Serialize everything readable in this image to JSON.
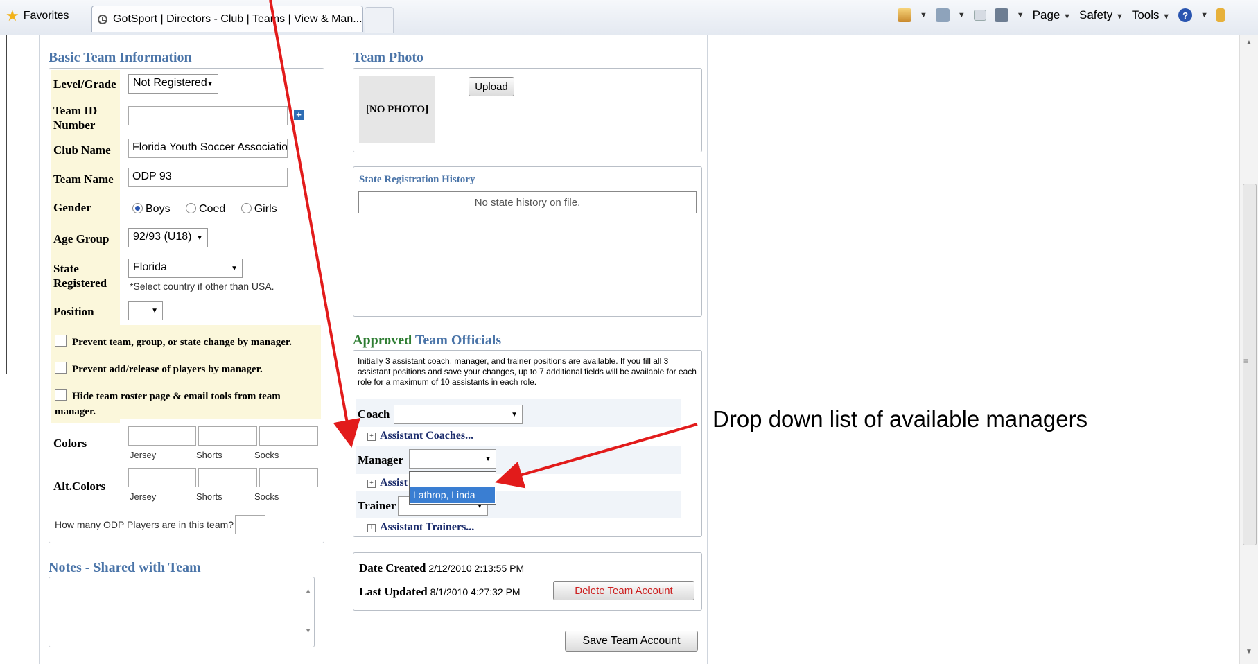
{
  "browser": {
    "favorites_label": "Favorites",
    "tab_title": "GotSport | Directors - Club | Teams | View & Man...",
    "menu": {
      "page": "Page",
      "safety": "Safety",
      "tools": "Tools",
      "help_glyph": "?"
    },
    "icons": [
      "home-icon",
      "feeds-icon",
      "mail-icon",
      "print-icon",
      "help-icon",
      "research-icon"
    ]
  },
  "basic_info": {
    "title": "Basic Team Information",
    "level_label": "Level/Grade",
    "level_value": "Not Registered",
    "team_id_label": "Team ID Number",
    "team_id_value": "",
    "club_label": "Club Name",
    "club_value": "Florida Youth Soccer Association",
    "team_name_label": "Team Name",
    "team_name_value": "ODP 93",
    "gender_label": "Gender",
    "gender_options": [
      "Boys",
      "Coed",
      "Girls"
    ],
    "gender_selected": "Boys",
    "age_label": "Age Group",
    "age_value": "92/93 (U18)",
    "state_label": "State Registered",
    "state_value": "Florida",
    "state_hint": "*Select country if other than USA.",
    "position_label": "Position",
    "position_value": "",
    "checks": [
      "Prevent team, group, or state change by manager.",
      "Prevent add/release of players by manager.",
      "Hide team roster page & email tools from team manager."
    ],
    "colors_label": "Colors",
    "alt_colors_label": "Alt.Colors",
    "color_fields": [
      "Jersey",
      "Shorts",
      "Socks"
    ],
    "odp_question": "How many ODP Players are in this team?"
  },
  "notes": {
    "title": "Notes - Shared with Team",
    "value": ""
  },
  "photo": {
    "title": "Team Photo",
    "placeholder": "[NO PHOTO]",
    "upload_label": "Upload"
  },
  "history": {
    "title": "State Registration History",
    "empty_text": "No state history on file."
  },
  "officials": {
    "title_part1": "Approved",
    "title_part2": " Team Officials",
    "note": "Initially 3 assistant coach, manager, and trainer positions are available. If you fill all 3 assistant positions and save your changes, up to 7 additional fields will be available for each role for a maximum of 10 assistants in each role.",
    "coach_label": "Coach",
    "assistant_coaches": "Assistant Coaches...",
    "manager_label": "Manager",
    "assistant_managers_partial": "Assist",
    "manager_option": "Lathrop, Linda",
    "trainer_label": "Trainer",
    "assistant_trainers": "Assistant Trainers..."
  },
  "dates": {
    "created_label": "Date Created",
    "created_value": "2/12/2010 2:13:55 PM",
    "updated_label": "Last Updated",
    "updated_value": "8/1/2010 4:27:32 PM",
    "delete_label": "Delete Team Account",
    "save_label": "Save Team Account"
  },
  "annotation": {
    "text": "Drop down list of available managers"
  },
  "colors": {
    "heading_blue": "#4a74a8",
    "heading_green": "#2e7d32",
    "annotation_red": "#e21b1b",
    "label_bg": "#fbf7db",
    "highlight": "#3a7ed2"
  }
}
